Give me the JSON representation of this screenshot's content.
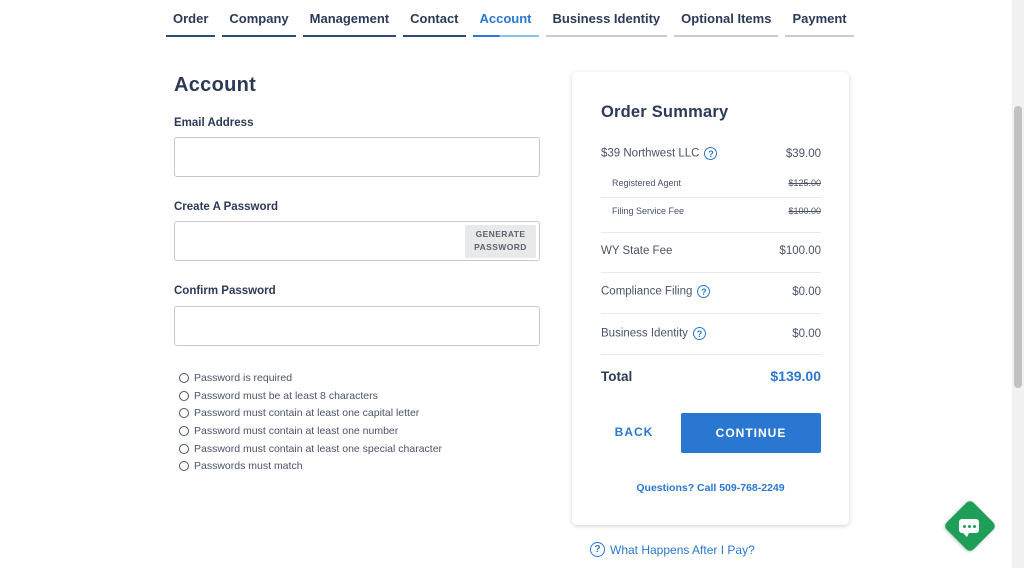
{
  "steps": [
    {
      "label": "Order",
      "state": "done"
    },
    {
      "label": "Company",
      "state": "done"
    },
    {
      "label": "Management",
      "state": "done"
    },
    {
      "label": "Contact",
      "state": "done"
    },
    {
      "label": "Account",
      "state": "active"
    },
    {
      "label": "Business Identity",
      "state": "pending"
    },
    {
      "label": "Optional Items",
      "state": "pending"
    },
    {
      "label": "Payment",
      "state": "pending"
    }
  ],
  "form": {
    "title": "Account",
    "email_label": "Email Address",
    "email_value": "",
    "password_label": "Create A Password",
    "password_value": "",
    "generate_button_line1": "GENERATE",
    "generate_button_line2": "PASSWORD",
    "confirm_label": "Confirm Password",
    "confirm_value": "",
    "rules": [
      "Password is required",
      "Password must be at least 8 characters",
      "Password must contain at least one capital letter",
      "Password must contain at least one number",
      "Password must contain at least one special character",
      "Passwords must match"
    ]
  },
  "summary": {
    "title": "Order Summary",
    "product": {
      "label": "$39 Northwest LLC",
      "amount": "$39.00"
    },
    "registered_agent": {
      "label": "Registered Agent",
      "amount": "$125.00"
    },
    "filing_fee": {
      "label": "Filing Service Fee",
      "amount": "$100.00"
    },
    "state_fee": {
      "label": "WY State Fee",
      "amount": "$100.00"
    },
    "compliance": {
      "label": "Compliance Filing",
      "amount": "$0.00"
    },
    "business_identity": {
      "label": "Business Identity",
      "amount": "$0.00"
    },
    "total": {
      "label": "Total",
      "amount": "$139.00"
    },
    "back_label": "BACK",
    "continue_label": "CONTINUE",
    "questions": "Questions? Call 509-768-2249"
  },
  "after_pay_link": "What Happens After I Pay?",
  "colors": {
    "accent": "#2a77d1",
    "chat": "#1e9e58",
    "text": "#2b3a57"
  },
  "icons": {
    "help": "help-circle-icon",
    "chat": "chat-icon",
    "rule": "circle-icon"
  }
}
